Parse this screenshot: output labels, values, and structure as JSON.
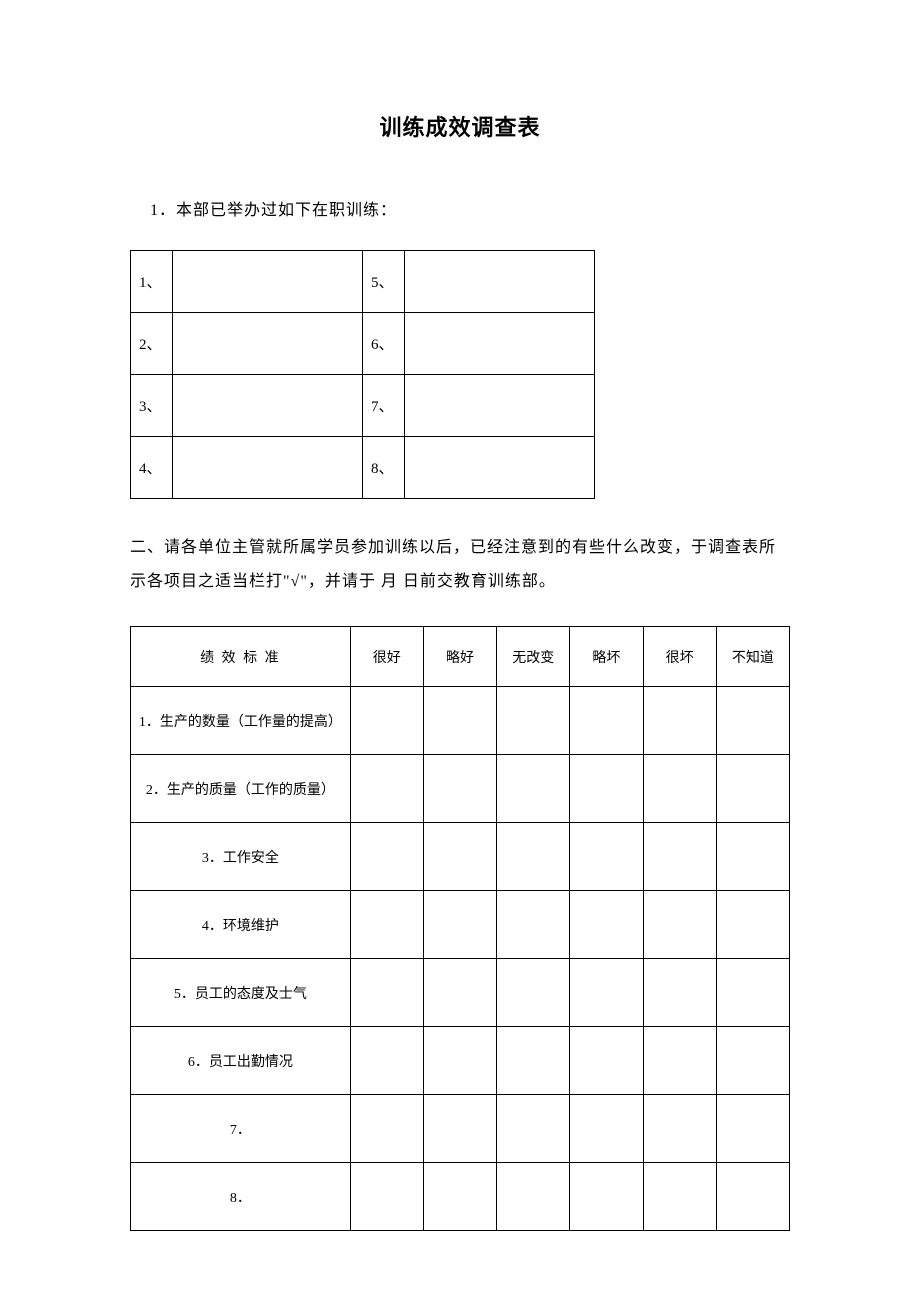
{
  "title": "训练成效调查表",
  "section1": {
    "text": "1．本部已举办过如下在职训练：",
    "training_rows": [
      {
        "left_num": "1、",
        "left_val": "",
        "right_num": "5、",
        "right_val": ""
      },
      {
        "left_num": "2、",
        "left_val": "",
        "right_num": "6、",
        "right_val": ""
      },
      {
        "left_num": "3、",
        "left_val": "",
        "right_num": "7、",
        "right_val": ""
      },
      {
        "left_num": "4、",
        "left_val": "",
        "right_num": "8、",
        "right_val": ""
      }
    ]
  },
  "section2": {
    "text": "二、请各单位主管就所属学员参加训练以后，已经注意到的有些什么改变，于调查表所示各项目之适当栏打\"√\"，并请于  月  日前交教育训练部。"
  },
  "eval_table": {
    "header": {
      "criteria": "绩 效 标 准",
      "cols": [
        "很好",
        "略好",
        "无改变",
        "略坏",
        "很坏",
        "不知道"
      ]
    },
    "rows": [
      "1．生产的数量（工作量的提高）",
      "2．生产的质量（工作的质量）",
      "3．工作安全",
      "4．环境维护",
      "5．员工的态度及士气",
      "6．员工出勤情况",
      "7．",
      "8．"
    ]
  }
}
